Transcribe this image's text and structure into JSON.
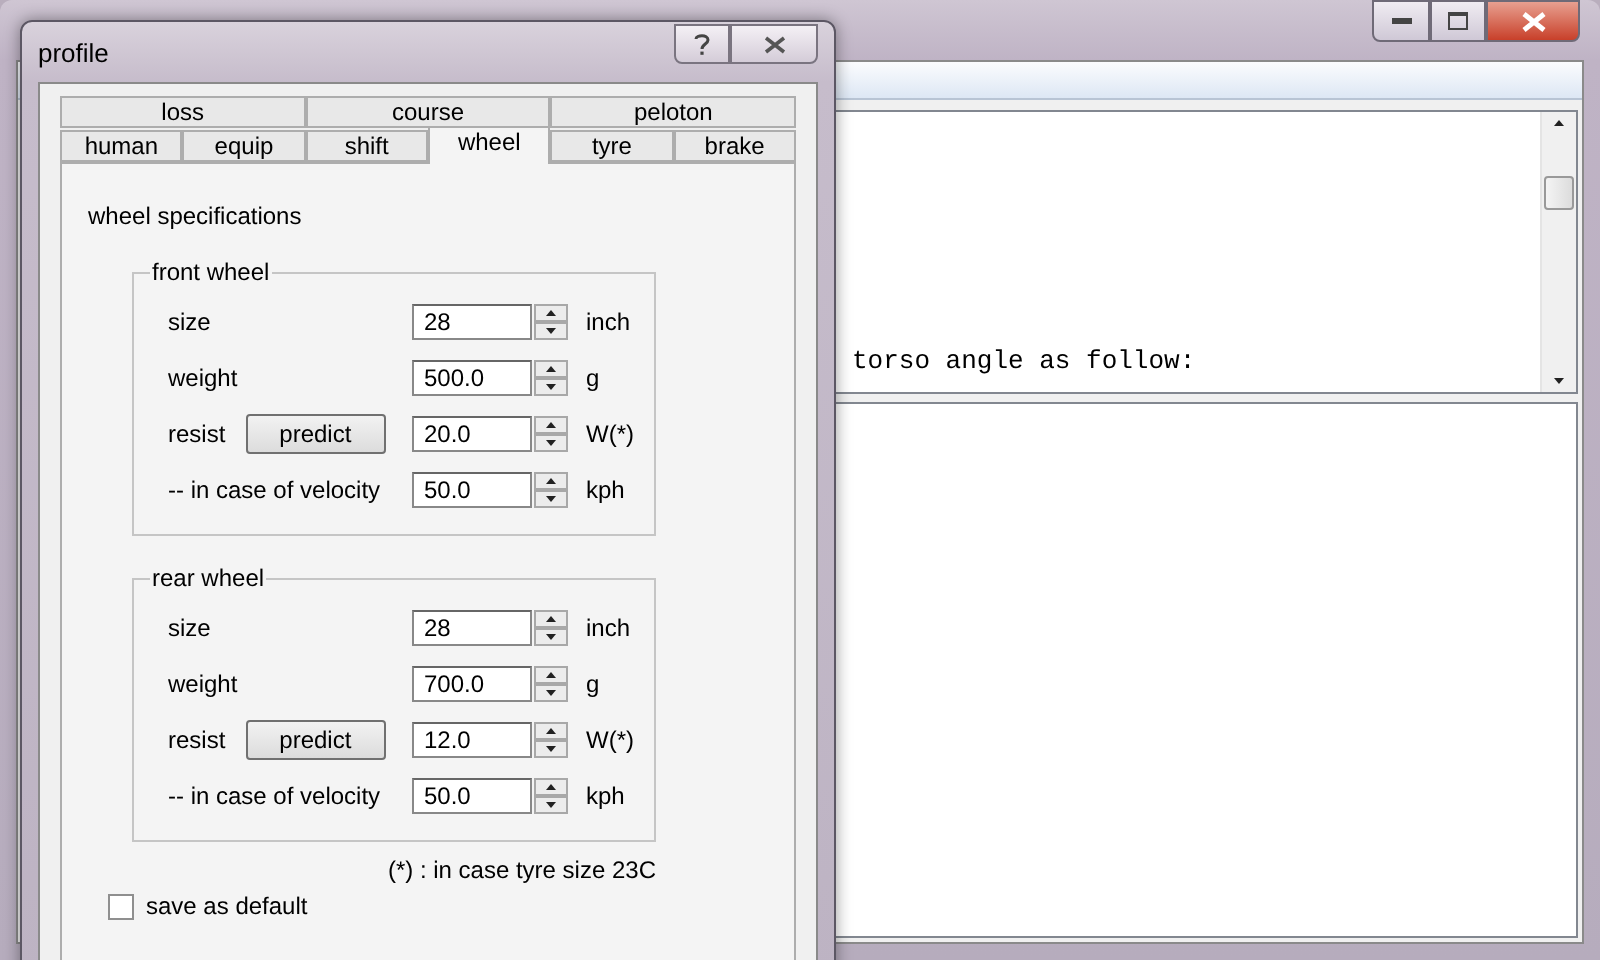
{
  "main_window": {
    "output_text": "torso angle as follow:"
  },
  "dialog": {
    "title": "profile",
    "tab_rows": [
      [
        {
          "label": "loss",
          "selected": false
        },
        {
          "label": "course",
          "selected": false
        },
        {
          "label": "peloton",
          "selected": false
        }
      ],
      [
        {
          "label": "human",
          "selected": false
        },
        {
          "label": "equip",
          "selected": false
        },
        {
          "label": "shift",
          "selected": false
        },
        {
          "label": "wheel",
          "selected": true
        },
        {
          "label": "tyre",
          "selected": false
        },
        {
          "label": "brake",
          "selected": false
        }
      ]
    ],
    "section_title": "wheel specifications",
    "groups": [
      {
        "title": "front wheel",
        "rows": [
          {
            "kind": "spin",
            "label": "size",
            "value": "28",
            "unit": "inch"
          },
          {
            "kind": "spin",
            "label": "weight",
            "value": "500.0",
            "unit": "g"
          },
          {
            "kind": "predict",
            "label": "resist",
            "button": "predict",
            "value": "20.0",
            "unit": "W(*)"
          },
          {
            "kind": "spin",
            "label": "-- in case of velocity",
            "value": "50.0",
            "unit": "kph"
          }
        ]
      },
      {
        "title": "rear wheel",
        "rows": [
          {
            "kind": "spin",
            "label": "size",
            "value": "28",
            "unit": "inch"
          },
          {
            "kind": "spin",
            "label": "weight",
            "value": "700.0",
            "unit": "g"
          },
          {
            "kind": "predict",
            "label": "resist",
            "button": "predict",
            "value": "12.0",
            "unit": "W(*)"
          },
          {
            "kind": "spin",
            "label": "-- in case of velocity",
            "value": "50.0",
            "unit": "kph"
          }
        ]
      }
    ],
    "footnote": "(*) : in case tyre size 23C",
    "save_default": {
      "label": "save as default",
      "checked": false
    }
  }
}
